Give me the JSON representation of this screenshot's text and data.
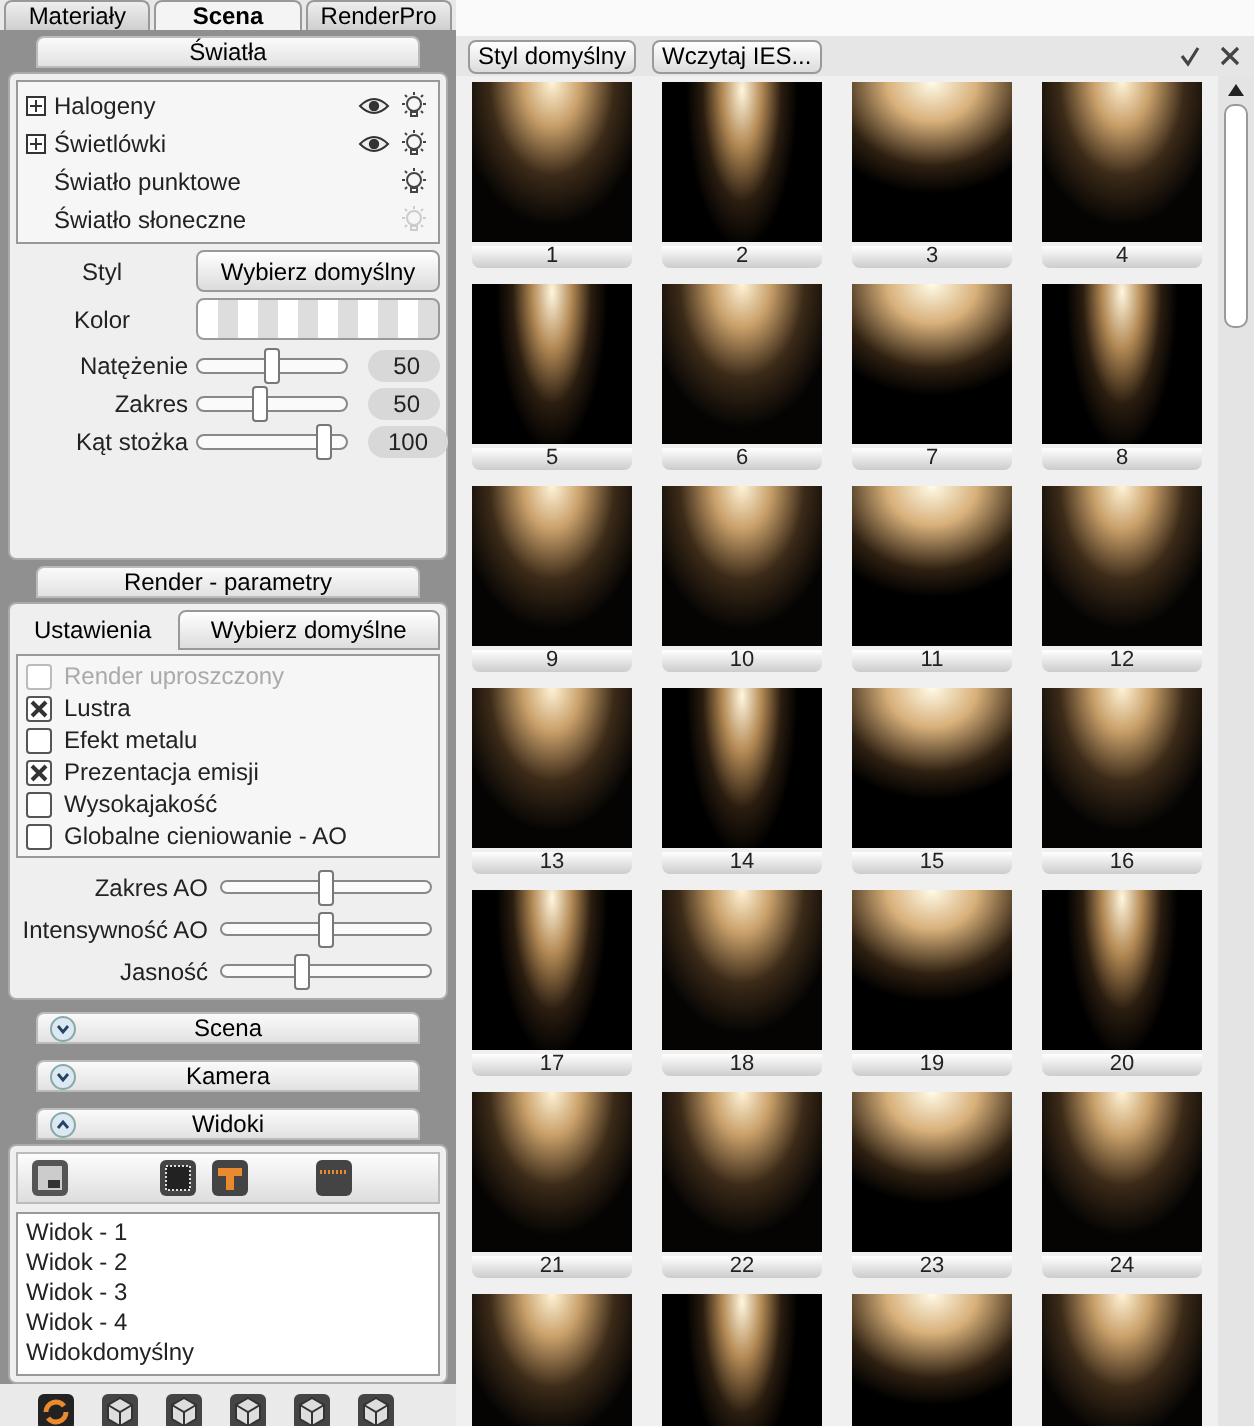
{
  "tabs": [
    {
      "label": "Materiały",
      "selected": false
    },
    {
      "label": "Scena",
      "selected": true
    },
    {
      "label": "RenderPro",
      "selected": false
    }
  ],
  "lights_section": {
    "title": "Światła",
    "items": [
      {
        "name": "Halogeny",
        "kind": "group",
        "on": true
      },
      {
        "name": "Świetlówki",
        "kind": "group",
        "on": true
      },
      {
        "name": "Światło punktowe",
        "kind": "light",
        "on": true
      },
      {
        "name": "Światło słoneczne",
        "kind": "light",
        "on": false
      }
    ],
    "style_label": "Styl",
    "style_button": "Wybierz domyślny",
    "color_label": "Kolor",
    "sliders": [
      {
        "label": "Natężenie",
        "level": 0.5,
        "reading": "50"
      },
      {
        "label": "Zakres",
        "level": 0.42,
        "reading": "50"
      },
      {
        "label": "Kąt stożka",
        "level": 0.85,
        "reading": "100"
      }
    ]
  },
  "render_section": {
    "title": "Render - parametry",
    "tabs": [
      {
        "label": "Ustawienia",
        "selected": true
      },
      {
        "label": "Wybierz domyślne",
        "selected": false
      }
    ],
    "options": [
      {
        "label": "Render uproszczony",
        "checked": false,
        "disabled": true
      },
      {
        "label": "Lustra",
        "checked": true,
        "disabled": false
      },
      {
        "label": "Efekt metalu",
        "checked": false,
        "disabled": false
      },
      {
        "label": "Prezentacja emisji",
        "checked": true,
        "disabled": false
      },
      {
        "label": "Wysokajakość",
        "checked": false,
        "disabled": false
      },
      {
        "label": "Globalne cieniowanie - AO",
        "checked": false,
        "disabled": false
      }
    ],
    "sliders": [
      {
        "label": "Zakres AO",
        "level": 0.5
      },
      {
        "label": "Intensywność AO",
        "level": 0.5
      },
      {
        "label": "Jasność",
        "level": 0.38
      }
    ]
  },
  "collapsed_sections": [
    {
      "title": "Scena",
      "expanded": false
    },
    {
      "title": "Kamera",
      "expanded": false
    },
    {
      "title": "Widoki",
      "expanded": true
    }
  ],
  "views": [
    "Widok - 1",
    "Widok - 2",
    "Widok - 3",
    "Widok - 4",
    "Widokdomyślny"
  ],
  "toolbar": {
    "buttons": [
      "Styl domyślny",
      "Wczytaj IES..."
    ]
  },
  "presets": [
    {
      "label": "1"
    },
    {
      "label": "2"
    },
    {
      "label": "3"
    },
    {
      "label": "4"
    },
    {
      "label": "5"
    },
    {
      "label": "6"
    },
    {
      "label": "7"
    },
    {
      "label": "8"
    },
    {
      "label": "9"
    },
    {
      "label": "10"
    },
    {
      "label": "11"
    },
    {
      "label": "12"
    },
    {
      "label": "13"
    },
    {
      "label": "14"
    },
    {
      "label": "15"
    },
    {
      "label": "16"
    },
    {
      "label": "17"
    },
    {
      "label": "18"
    },
    {
      "label": "19"
    },
    {
      "label": "20"
    },
    {
      "label": "21"
    },
    {
      "label": "22"
    },
    {
      "label": "23"
    },
    {
      "label": "24"
    }
  ]
}
